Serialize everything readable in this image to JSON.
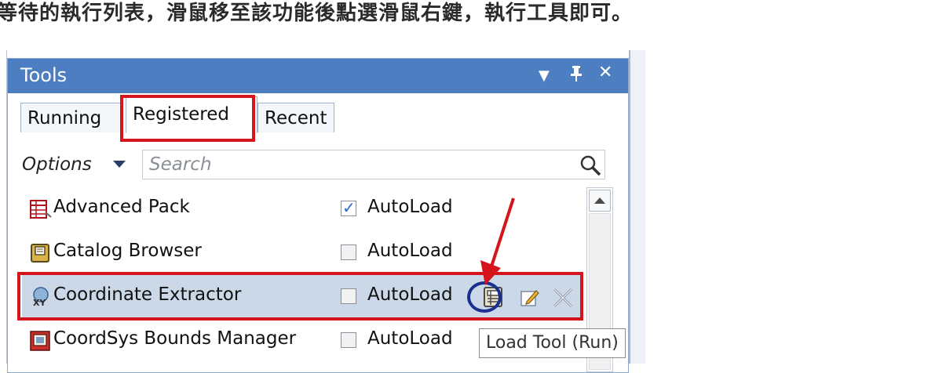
{
  "caption": "等待的執行列表，滑鼠移至該功能後點選滑鼠右鍵，執行工具即可。",
  "window": {
    "title": "Tools"
  },
  "tabs": [
    {
      "label": "Running"
    },
    {
      "label": "Registered",
      "active": true
    },
    {
      "label": "Recent"
    }
  ],
  "toolbar": {
    "options_label": "Options",
    "search_placeholder": "Search"
  },
  "tools": [
    {
      "name": "Advanced Pack",
      "autoload_label": "AutoLoad",
      "autoload": true,
      "icon": "table-chart-icon"
    },
    {
      "name": "Catalog Browser",
      "autoload_label": "AutoLoad",
      "autoload": false,
      "icon": "catalog-book-icon"
    },
    {
      "name": "Coordinate Extractor",
      "autoload_label": "AutoLoad",
      "autoload": false,
      "icon": "xy-coordinate-icon",
      "selected": true
    },
    {
      "name": "CoordSys Bounds Manager",
      "autoload_label": "AutoLoad",
      "autoload": false,
      "icon": "bounds-map-icon"
    }
  ],
  "tooltip": "Load Tool (Run)",
  "colors": {
    "titlebar": "#4d7ec1",
    "highlight_red": "#d6141b",
    "highlight_blue": "#1b2f8f",
    "selected_row": "#cbd8e8"
  }
}
